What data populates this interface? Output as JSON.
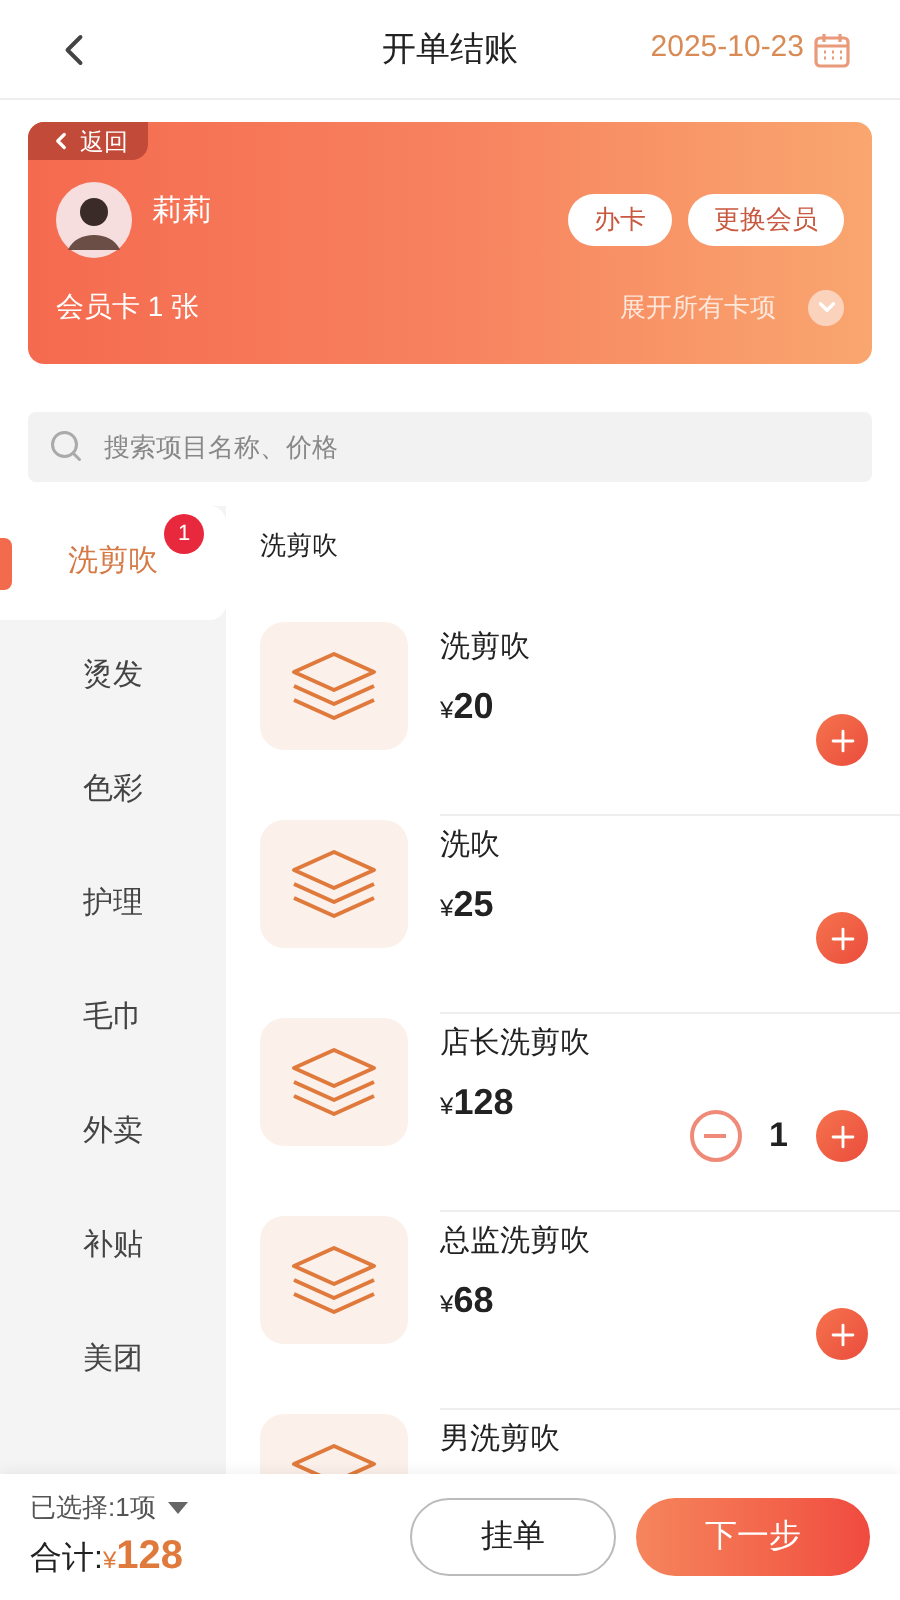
{
  "header": {
    "title": "开单结账",
    "date": "2025-10-23"
  },
  "member": {
    "back": "返回",
    "name": "莉莉",
    "buttons": [
      "办卡",
      "更换会员"
    ],
    "cards": "会员卡 1 张",
    "expand": "展开所有卡项"
  },
  "search": {
    "placeholder": "搜索项目名称、价格"
  },
  "categories": [
    {
      "label": "洗剪吹",
      "selected": true,
      "badge": "1"
    },
    {
      "label": "烫发",
      "selected": false
    },
    {
      "label": "色彩",
      "selected": false
    },
    {
      "label": "护理",
      "selected": false
    },
    {
      "label": "毛巾",
      "selected": false
    },
    {
      "label": "外卖",
      "selected": false
    },
    {
      "label": "补贴",
      "selected": false
    },
    {
      "label": "美团",
      "selected": false
    }
  ],
  "section_title": "洗剪吹",
  "items": [
    {
      "name": "洗剪吹",
      "currency": "¥",
      "price": "20"
    },
    {
      "name": "洗吹",
      "currency": "¥",
      "price": "25"
    },
    {
      "name": "店长洗剪吹",
      "currency": "¥",
      "price": "128",
      "quantity": "1"
    },
    {
      "name": "总监洗剪吹",
      "currency": "¥",
      "price": "68"
    },
    {
      "name": "男洗剪吹"
    }
  ],
  "footer": {
    "selected": "已选择:1项",
    "total_label": "合计:",
    "currency": "¥",
    "total": "128",
    "hold": "挂单",
    "next": "下一步"
  }
}
